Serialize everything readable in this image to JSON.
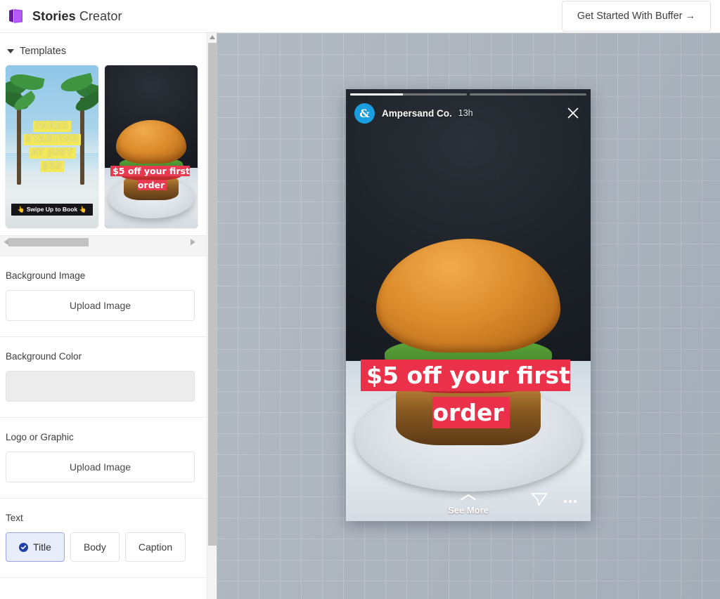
{
  "header": {
    "brand_bold": "Stories",
    "brand_light": " Creator",
    "logo_icon": "book-logo-icon",
    "cta_label": "Get Started With Buffer →"
  },
  "sidebar": {
    "templates": {
      "label": "Templates",
      "caret_icon": "chevron-down-icon",
      "items": [
        {
          "name": "beach-fares-template",
          "lines": [
            "FARES",
            "STARTING",
            "AT JUST",
            "$59"
          ],
          "cta": "👆 Swipe Up to Book 👆"
        },
        {
          "name": "burger-offer-template",
          "text": "$5 off your first order"
        }
      ]
    },
    "background_image": {
      "label": "Background Image",
      "button": "Upload Image"
    },
    "background_color": {
      "label": "Background Color",
      "value": ""
    },
    "logo_or_graphic": {
      "label": "Logo or Graphic",
      "button": "Upload Image"
    },
    "text": {
      "label": "Text",
      "tabs": [
        {
          "label": "Title",
          "selected": true
        },
        {
          "label": "Body",
          "selected": false
        },
        {
          "label": "Caption",
          "selected": false
        }
      ]
    }
  },
  "preview": {
    "progress": {
      "segments": 2,
      "active_index": 0,
      "active_percent": 45
    },
    "avatar_initial": "&",
    "account": "Ampersand Co.",
    "timestamp": "13h",
    "close_icon": "close-icon",
    "overlay_text": "$5 off your first order",
    "overlay_bg_color": "#ea3149",
    "see_more": {
      "label": "See More",
      "icon": "chevron-up-icon"
    },
    "send_icon": "send-icon",
    "more_icon": "more-dots-icon"
  },
  "colors": {
    "brand_purple": "#8b2fd6",
    "accent_blue": "#1f3fa8",
    "avatar_blue": "#199fe0",
    "highlight_red": "#ea3149",
    "canvas_bg": "#aab2bc"
  }
}
